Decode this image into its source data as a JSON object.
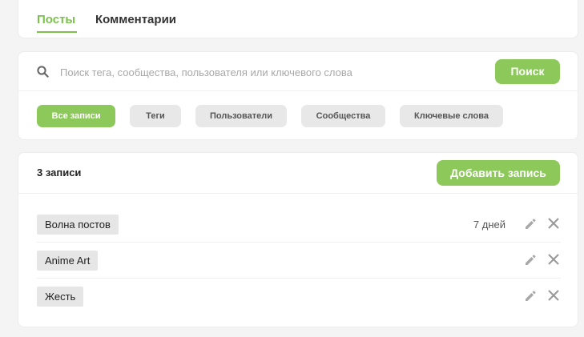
{
  "tabs": [
    {
      "label": "Посты",
      "active": true
    },
    {
      "label": "Комментарии",
      "active": false
    }
  ],
  "search": {
    "placeholder": "Поиск тега, сообщества, пользователя или ключевого слова",
    "value": "",
    "button_label": "Поиск"
  },
  "filters": [
    {
      "label": "Все записи",
      "active": true
    },
    {
      "label": "Теги",
      "active": false
    },
    {
      "label": "Пользователи",
      "active": false
    },
    {
      "label": "Сообщества",
      "active": false
    },
    {
      "label": "Ключевые слова",
      "active": false
    }
  ],
  "list": {
    "count_label": "3 записи",
    "add_button_label": "Добавить запись",
    "items": [
      {
        "name": "Волна постов",
        "time": "7 дней"
      },
      {
        "name": "Anime Art",
        "time": ""
      },
      {
        "name": "Жесть",
        "time": ""
      }
    ]
  },
  "colors": {
    "accent": "#8cc85a",
    "accent_text": "#7bc14b",
    "pill_bg": "#e6e6e6",
    "page_bg": "#f4f4f4"
  },
  "icons": {
    "search": "search-icon",
    "edit": "pencil-icon",
    "delete": "close-icon"
  }
}
